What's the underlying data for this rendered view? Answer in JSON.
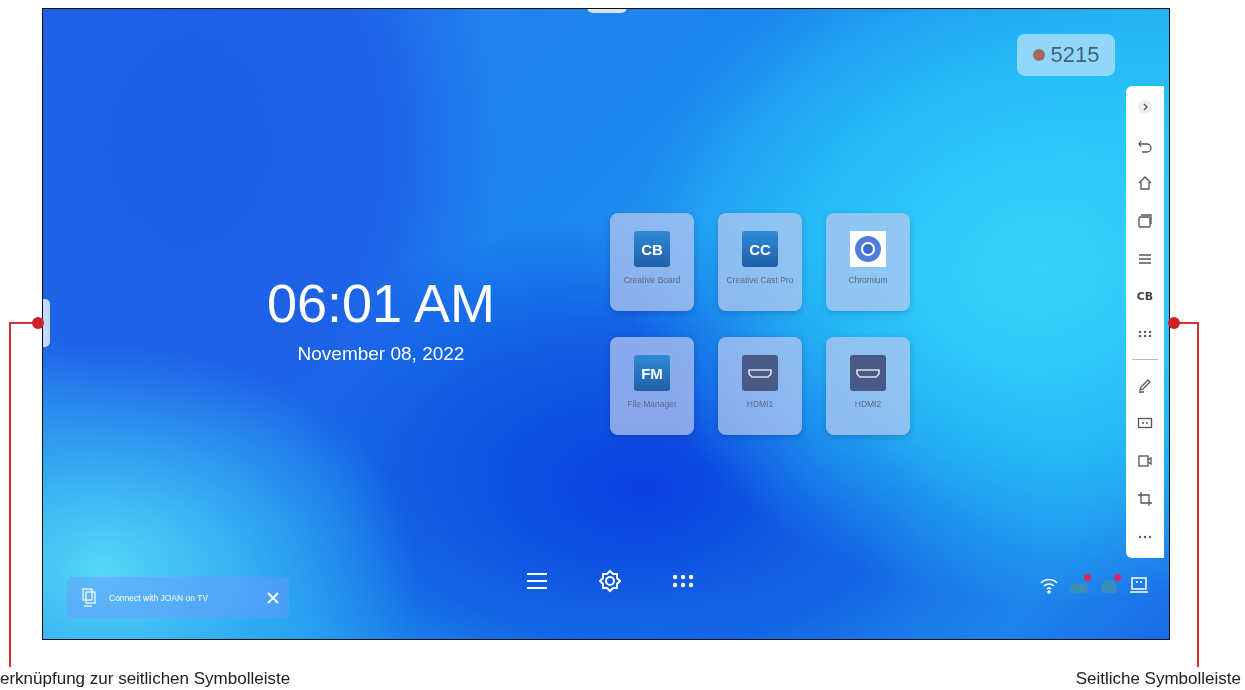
{
  "clock": {
    "time": "06:01 AM",
    "date": "November 08, 2022"
  },
  "counter": {
    "value": "5215"
  },
  "apps": [
    {
      "kind": "cb",
      "logo_text": "CB",
      "label": "Creative Board"
    },
    {
      "kind": "cc",
      "logo_text": "CC",
      "label": "Creative Cast Pro"
    },
    {
      "kind": "chromium",
      "label": "Chromium"
    },
    {
      "kind": "fm",
      "logo_text": "FM",
      "label": "File Manager"
    },
    {
      "kind": "hdmi",
      "label": "HDMI1"
    },
    {
      "kind": "hdmi",
      "label": "HDMI2"
    }
  ],
  "toolbar": [
    {
      "kind": "collapse"
    },
    {
      "kind": "back"
    },
    {
      "kind": "home"
    },
    {
      "kind": "windows"
    },
    {
      "kind": "menu"
    },
    {
      "kind": "cb",
      "text": "CB"
    },
    {
      "kind": "apps"
    },
    {
      "kind": "divider"
    },
    {
      "kind": "pen"
    },
    {
      "kind": "split"
    },
    {
      "kind": "record"
    },
    {
      "kind": "crop"
    },
    {
      "kind": "more"
    }
  ],
  "dock": [
    {
      "kind": "menu"
    },
    {
      "kind": "settings"
    },
    {
      "kind": "apps"
    }
  ],
  "toast": {
    "text": "Connect with JOAN on TV"
  },
  "tray": [
    {
      "kind": "wifi",
      "alert": false
    },
    {
      "kind": "gamepad",
      "alert": true
    },
    {
      "kind": "usb",
      "alert": true
    },
    {
      "kind": "network",
      "alert": false
    }
  ],
  "callouts": [
    {
      "label": "erknüpfung zur seitlichen Symbolleiste"
    },
    {
      "label": "Seitliche Symbolleiste"
    }
  ]
}
